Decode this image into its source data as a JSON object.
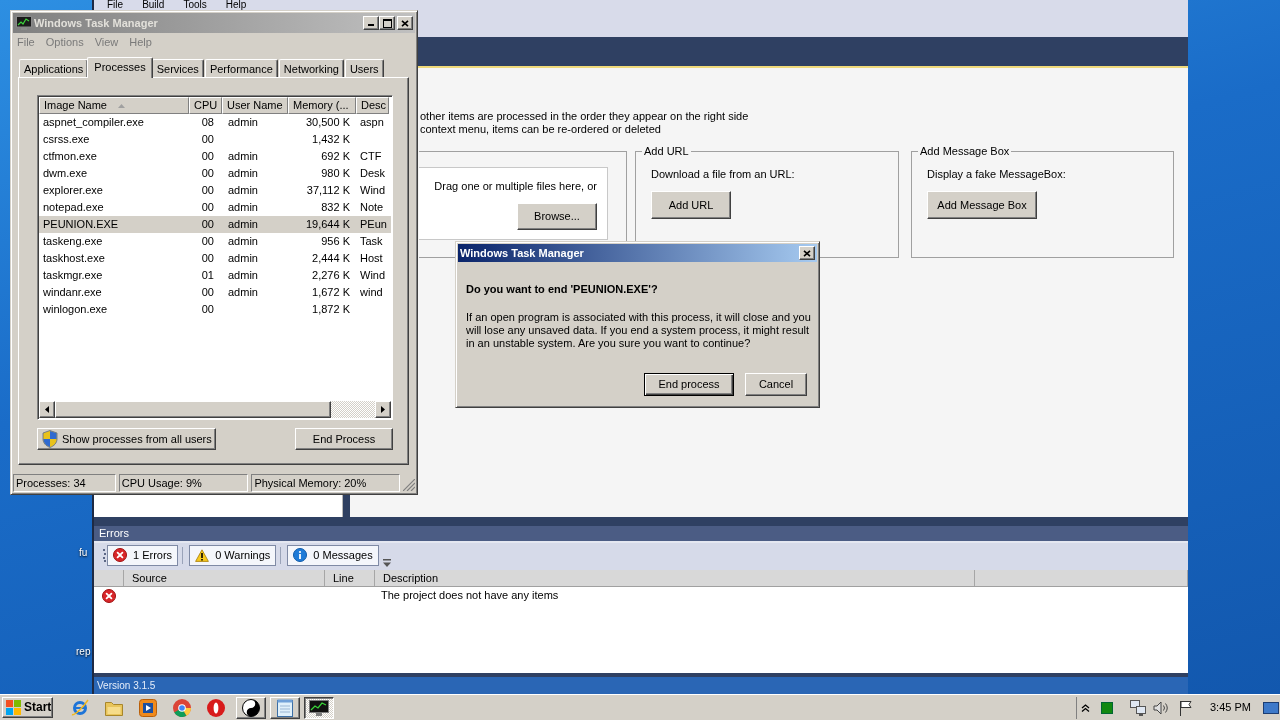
{
  "desktop": {
    "icon_labels": [
      "fu",
      "rep"
    ]
  },
  "app_window": {
    "menu": [
      "File",
      "Build",
      "Tools",
      "Help"
    ],
    "instructions": [
      "other items are processed in the order they appear on the right side",
      "context menu, items can be re-ordered or deleted"
    ],
    "groups": [
      {
        "kind": "drop",
        "text": "Drag one or multiple files here, or",
        "button": "Browse..."
      },
      {
        "kind": "action",
        "title": "Add URL",
        "text": "Download a file from an URL:",
        "button": "Add URL"
      },
      {
        "kind": "action",
        "title": "Add Message Box",
        "text": "Display a fake MessageBox:",
        "button": "Add Message Box"
      }
    ],
    "errors_panel": {
      "title": "Errors",
      "filters": [
        {
          "kind": "error",
          "label": "1 Errors",
          "checked": true
        },
        {
          "kind": "warning",
          "label": "0 Warnings",
          "checked": true
        },
        {
          "kind": "info",
          "label": "0 Messages",
          "checked": true
        }
      ],
      "columns": [
        "Source",
        "Line",
        "Description"
      ],
      "rows": [
        {
          "kind": "error",
          "description": "The project does not have any items"
        }
      ]
    },
    "status_bar": "Version 3.1.5"
  },
  "task_manager": {
    "title": "Windows Task Manager",
    "menu": [
      {
        "label": "File",
        "disabled": true
      },
      {
        "label": "Options",
        "disabled": true
      },
      {
        "label": "View",
        "disabled": true
      },
      {
        "label": "Help",
        "disabled": true
      }
    ],
    "tabs": [
      {
        "label": "Applications",
        "selected": false
      },
      {
        "label": "Processes",
        "selected": true
      },
      {
        "label": "Services",
        "selected": false
      },
      {
        "label": "Performance",
        "selected": false
      },
      {
        "label": "Networking",
        "selected": false
      },
      {
        "label": "Users",
        "selected": false
      }
    ],
    "columns": [
      {
        "label": "Image Name",
        "sorted": true
      },
      {
        "label": "CPU",
        "sorted": false
      },
      {
        "label": "User Name",
        "sorted": false
      },
      {
        "label": "Memory (...",
        "sorted": false
      },
      {
        "label": "Desc",
        "sorted": false
      }
    ],
    "processes": [
      {
        "image_name": "aspnet_compiler.exe",
        "cpu": "08",
        "user_name": "admin",
        "memory": "30,500 K",
        "description": "aspn",
        "selected": false
      },
      {
        "image_name": "csrss.exe",
        "cpu": "00",
        "memory": "1,432 K",
        "selected": false
      },
      {
        "image_name": "ctfmon.exe",
        "cpu": "00",
        "user_name": "admin",
        "memory": "692 K",
        "description": "CTF",
        "selected": false
      },
      {
        "image_name": "dwm.exe",
        "cpu": "00",
        "user_name": "admin",
        "memory": "980 K",
        "description": "Desk",
        "selected": false
      },
      {
        "image_name": "explorer.exe",
        "cpu": "00",
        "user_name": "admin",
        "memory": "37,112 K",
        "description": "Wind",
        "selected": false
      },
      {
        "image_name": "notepad.exe",
        "cpu": "00",
        "user_name": "admin",
        "memory": "832 K",
        "description": "Note",
        "selected": false
      },
      {
        "image_name": "PEUNION.EXE",
        "cpu": "00",
        "user_name": "admin",
        "memory": "19,644 K",
        "description": "PEun",
        "selected": true
      },
      {
        "image_name": "taskeng.exe",
        "cpu": "00",
        "user_name": "admin",
        "memory": "956 K",
        "description": "Task",
        "selected": false
      },
      {
        "image_name": "taskhost.exe",
        "cpu": "00",
        "user_name": "admin",
        "memory": "2,444 K",
        "description": "Host",
        "selected": false
      },
      {
        "image_name": "taskmgr.exe",
        "cpu": "01",
        "user_name": "admin",
        "memory": "2,276 K",
        "description": "Wind",
        "selected": false
      },
      {
        "image_name": "windanr.exe",
        "cpu": "00",
        "user_name": "admin",
        "memory": "1,672 K",
        "description": "wind",
        "selected": false
      },
      {
        "image_name": "winlogon.exe",
        "cpu": "00",
        "memory": "1,872 K",
        "selected": false
      }
    ],
    "show_all_button": "Show processes from all users",
    "end_process_button": "End Process",
    "status_bar": [
      "Processes: 34",
      "CPU Usage: 9%",
      "Physical Memory: 20%"
    ]
  },
  "dialog": {
    "title": "Windows Task Manager",
    "question": "Do you want to end 'PEUNION.EXE'?",
    "message": "If an open program is associated with this process, it will close and you will lose any unsaved data. If you end a system process, it might result in an unstable system. Are you sure you want to continue?",
    "buttons": [
      {
        "label": "End process",
        "default": true
      },
      {
        "label": "Cancel",
        "default": false
      }
    ]
  },
  "taskbar": {
    "start": "Start",
    "tasks": [
      {
        "selected": false
      },
      {
        "selected": false
      },
      {
        "selected": true
      }
    ],
    "clock": "3:45 PM"
  }
}
